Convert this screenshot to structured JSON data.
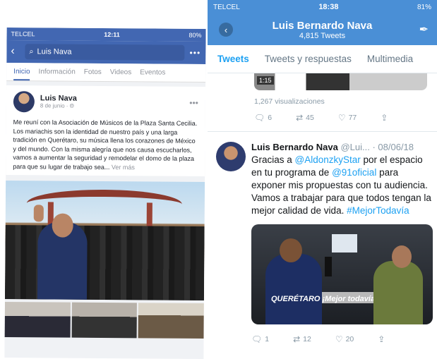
{
  "facebook": {
    "status": {
      "carrier": "TELCEL",
      "time": "12:11",
      "battery": "80%"
    },
    "search": {
      "query": "Luis Nava"
    },
    "tabs": [
      "Inicio",
      "Información",
      "Fotos",
      "Videos",
      "Eventos"
    ],
    "post": {
      "author": "Luis Nava",
      "date": "8 de junio",
      "text": "Me reuní con la Asociación de Músicos de la Plaza Santa Cecilia. Los mariachis son la identidad de nuestro país y una larga tradición en Querétaro, su música llena los corazones de México y del mundo. Con la misma alegría que nos causa escucharlos, vamos a aumentar la seguridad y remodelar el domo de la plaza para que su lugar de trabajo sea...",
      "see_more": "Ver más"
    }
  },
  "twitter": {
    "status": {
      "carrier": "TELCEL",
      "time": "18:38",
      "battery": "81%"
    },
    "header": {
      "name": "Luis Bernardo Nava",
      "tweet_count": "4,815 Tweets"
    },
    "tabs": [
      "Tweets",
      "Tweets y respuestas",
      "Multimedia"
    ],
    "previous_tweet": {
      "video_duration": "1:15",
      "views": "1,267 visualizaciones",
      "replies": "6",
      "retweets": "45",
      "likes": "77"
    },
    "tweet": {
      "display_name": "Luis Bernardo Nava",
      "handle": "@Lui...",
      "date": "· 08/06/18",
      "text_1": "Gracias a ",
      "mention_1": "@AldonzkyStar",
      "text_2": " por el espacio en tu programa de ",
      "mention_2": "@91oficial",
      "text_3": " para exponer mis propuestas con tu audiencia. Vamos a trabajar para que todos tengan la mejor calidad de vida. ",
      "hashtag": "#MejorTodavía",
      "photo_shirt_text": "QUERÉTARO ¡Mejor todavía!",
      "replies": "1",
      "retweets": "12",
      "likes": "20"
    }
  },
  "colors": {
    "facebook_blue": "#4267b2",
    "twitter_blue": "#1da1f2",
    "twitter_header": "#4a8fd6"
  }
}
